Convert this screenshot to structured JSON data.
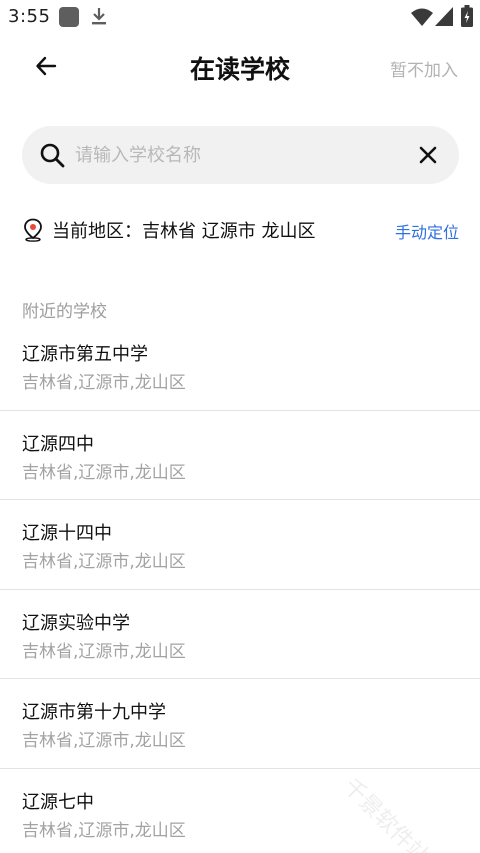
{
  "status_bar": {
    "time": "3:55",
    "icons": [
      "app-notification-icon",
      "download-icon",
      "wifi-icon",
      "cell-signal-icon",
      "battery-charging-icon"
    ]
  },
  "header": {
    "back_icon": "arrow-left-icon",
    "title": "在读学校",
    "skip_label": "暂不加入"
  },
  "search": {
    "placeholder": "请输入学校名称",
    "value": "",
    "search_icon": "search-icon",
    "clear_icon": "close-icon"
  },
  "location": {
    "icon": "map-pin-icon",
    "label": "当前地区：",
    "value": "吉林省 辽源市 龙山区",
    "manual_label": "手动定位",
    "accent_color": "#2f6fe0"
  },
  "nearby": {
    "section_title": "附近的学校",
    "schools": [
      {
        "name": "辽源市第五中学",
        "region": "吉林省,辽源市,龙山区"
      },
      {
        "name": "辽源四中",
        "region": "吉林省,辽源市,龙山区"
      },
      {
        "name": "辽源十四中",
        "region": "吉林省,辽源市,龙山区"
      },
      {
        "name": "辽源实验中学",
        "region": "吉林省,辽源市,龙山区"
      },
      {
        "name": "辽源市第十九中学",
        "region": "吉林省,辽源市,龙山区"
      },
      {
        "name": "辽源七中",
        "region": "吉林省,辽源市,龙山区"
      }
    ]
  },
  "watermark": "千景软件站"
}
